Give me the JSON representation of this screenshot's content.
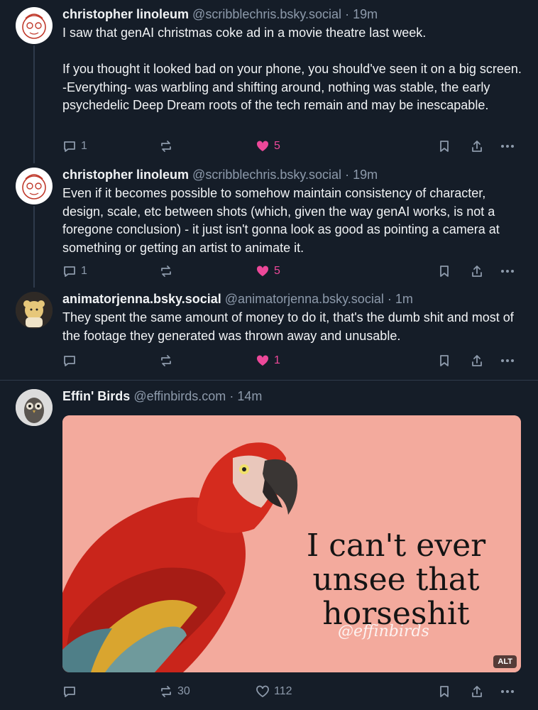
{
  "posts": [
    {
      "name": "christopher linoleum",
      "handle": "@scribblechris.bsky.social",
      "dot": "·",
      "time": "19m",
      "text": "I saw that genAI christmas coke ad in a movie theatre last week.\n\nIf you thought it looked bad on your phone, you should've seen it on a big screen. -Everything- was warbling and shifting around, nothing was stable, the early psychedelic Deep Dream roots of the tech remain and may be inescapable.",
      "replies": "1",
      "reposts": "",
      "likes": "5"
    },
    {
      "name": "christopher linoleum",
      "handle": "@scribblechris.bsky.social",
      "dot": "·",
      "time": "19m",
      "text": "Even if it becomes possible to somehow maintain consistency of character, design, scale, etc between shots (which, given the way genAI works, is not a foregone conclusion) - it just isn't gonna look as good as pointing a camera at something or getting an artist to animate it.",
      "replies": "1",
      "reposts": "",
      "likes": "5"
    },
    {
      "name": "animatorjenna.bsky.social",
      "handle": "@animatorjenna.bsky.social",
      "dot": "·",
      "time": "1m",
      "text": "They spent the same amount of money to do it, that's the dumb shit and most of the footage they generated was thrown away and unusable.",
      "replies": "",
      "reposts": "",
      "likes": "1"
    },
    {
      "name": "Effin' Birds",
      "handle": "@effinbirds.com",
      "dot": "·",
      "time": "14m",
      "text": "",
      "replies": "",
      "reposts": "30",
      "likes": "112",
      "image_caption": "I can't ever unsee that horseshit",
      "image_watermark": "@effinbirds",
      "alt_badge": "ALT"
    }
  ],
  "colors": {
    "background": "#151d28",
    "muted": "#8d9aab",
    "like": "#ec4899",
    "image_bg": "#f3aa9d"
  }
}
